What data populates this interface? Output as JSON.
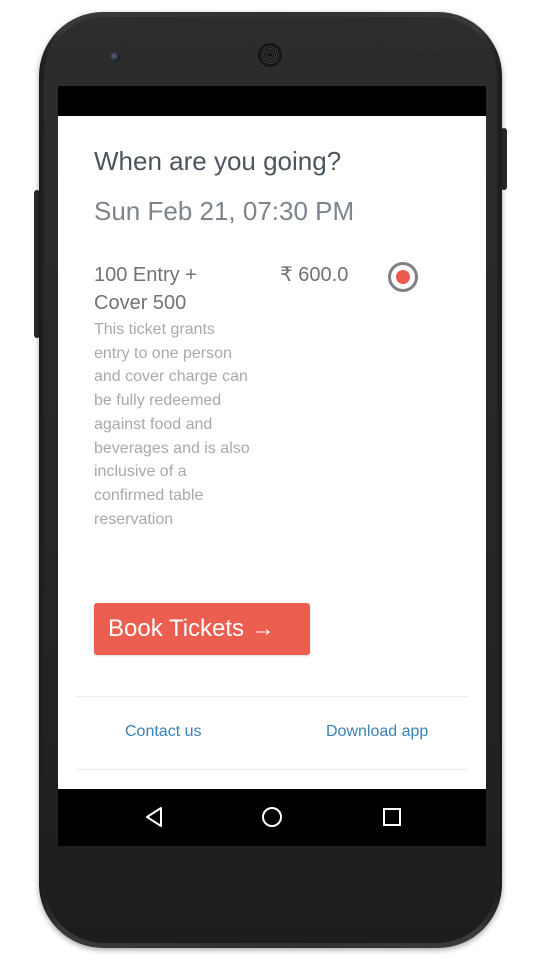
{
  "page": {
    "heading": "When are you going?",
    "date": "Sun Feb 21, 07:30 PM"
  },
  "ticket": {
    "name": "100 Entry + Cover 500",
    "price": "₹ 600.0",
    "description": "This ticket grants entry to one person and cover charge can be fully redeemed against food and beverages and is also inclusive of a confirmed table reservation",
    "selected": true
  },
  "actions": {
    "book_label": "Book Tickets →"
  },
  "footer": {
    "contact_label": "Contact us",
    "download_label": "Download app"
  },
  "navbar": {
    "icons": [
      "back-icon",
      "home-icon",
      "recent-apps-icon"
    ]
  },
  "colors": {
    "accent": "#ec5f50",
    "link": "#3a82b7",
    "heading": "#4c545c"
  }
}
